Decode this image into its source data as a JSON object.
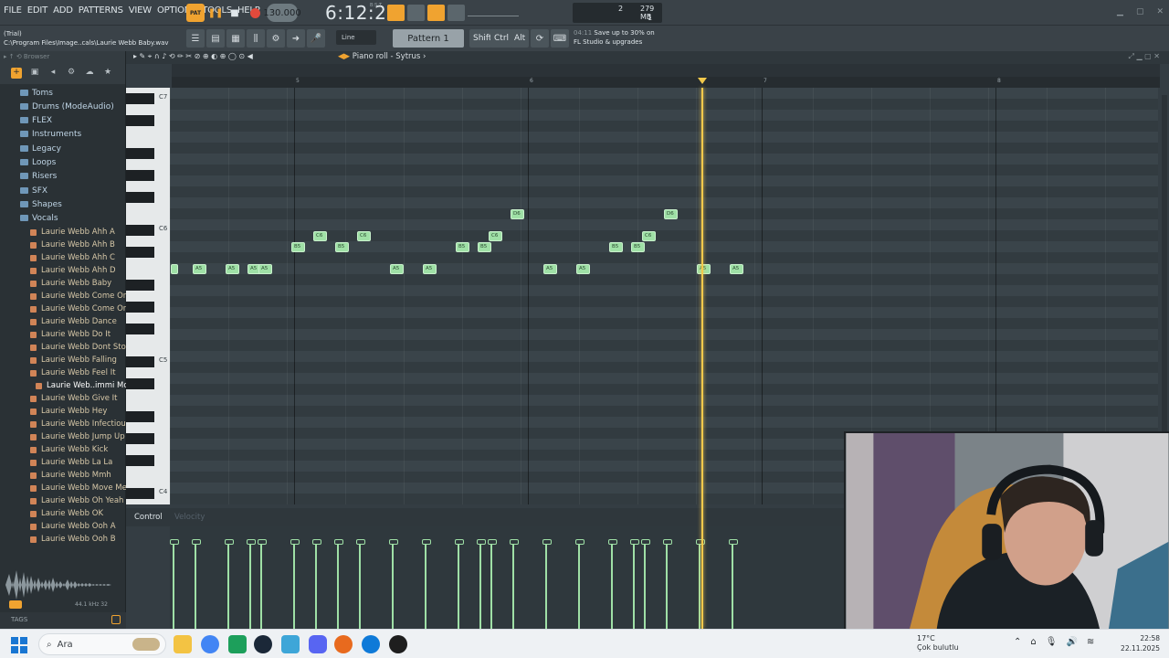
{
  "menu": [
    "FILE",
    "EDIT",
    "ADD",
    "PATTERNS",
    "VIEW",
    "OPTIONS",
    "TOOLS",
    "HELP"
  ],
  "transport": {
    "pat_label": "PAT",
    "song_label": "SONG",
    "tempo": "130.000",
    "time": "6:12:23",
    "time_unit": "B:S:T",
    "cpu": "2",
    "memory": "279 MB",
    "voices": "1"
  },
  "project": {
    "trial": "(Trial)",
    "path": "C:\\Program Files\\Image..cals\\Laurie Webb Baby.wav"
  },
  "toolbar2": {
    "snap": "Line",
    "pattern": "Pattern 1",
    "shift": "Shift",
    "ctrl": "Ctrl",
    "alt": "Alt"
  },
  "promo": {
    "time": "04:11",
    "line1": "Save up to 30% on",
    "line2": "FL Studio & upgrades"
  },
  "browser": {
    "header": "Browser",
    "folders": [
      "Toms",
      "Drums (ModeAudio)",
      "FLEX",
      "Instruments",
      "Legacy",
      "Loops",
      "Risers",
      "SFX",
      "Shapes",
      "Vocals"
    ],
    "files": [
      "Laurie Webb Ahh A",
      "Laurie Webb Ahh B",
      "Laurie Webb Ahh C",
      "Laurie Webb Ahh D",
      "Laurie Webb Baby",
      "Laurie Webb Come On A",
      "Laurie Webb Come On B",
      "Laurie Webb Dance",
      "Laurie Webb Do It",
      "Laurie Webb Dont Stop",
      "Laurie Webb Falling",
      "Laurie Webb Feel It",
      "Laurie Web..immi More",
      "Laurie Webb Give It",
      "Laurie Webb Hey",
      "Laurie Webb Infectious",
      "Laurie Webb Jump Up",
      "Laurie Webb Kick",
      "Laurie Webb La La",
      "Laurie Webb Mmh",
      "Laurie Webb Move Me",
      "Laurie Webb Oh Yeah",
      "Laurie Webb OK",
      "Laurie Webb Ooh A",
      "Laurie Webb Ooh B"
    ],
    "selected_file": "Laurie Web..immi More",
    "sample_info": "44.1 kHz 32",
    "tags": "TAGS"
  },
  "pianoroll": {
    "title": "Piano roll - Sytrus",
    "bars": [
      "5",
      "6",
      "7",
      "8"
    ],
    "octaves": [
      "C7",
      "C6",
      "C5",
      "C4"
    ],
    "control_label": "Control",
    "control_target": "Velocity",
    "notes": [
      {
        "label": "",
        "pitch": "A5",
        "beat": 0
      },
      {
        "label": "A5",
        "pitch": "A5",
        "beat": 1
      },
      {
        "label": "A5",
        "pitch": "A5",
        "beat": 2.5
      },
      {
        "label": "A5",
        "pitch": "A5",
        "beat": 3.5
      },
      {
        "label": "A5",
        "pitch": "A5",
        "beat": 4
      },
      {
        "label": "B5",
        "pitch": "B5",
        "beat": 5.5
      },
      {
        "label": "C6",
        "pitch": "C6",
        "beat": 6.5
      },
      {
        "label": "B5",
        "pitch": "B5",
        "beat": 7.5
      },
      {
        "label": "C6",
        "pitch": "C6",
        "beat": 8.5
      },
      {
        "label": "A5",
        "pitch": "A5",
        "beat": 10
      },
      {
        "label": "A5",
        "pitch": "A5",
        "beat": 11.5
      },
      {
        "label": "B5",
        "pitch": "B5",
        "beat": 13
      },
      {
        "label": "B5",
        "pitch": "B5",
        "beat": 14
      },
      {
        "label": "C6",
        "pitch": "C6",
        "beat": 14.5
      },
      {
        "label": "D6",
        "pitch": "D6",
        "beat": 15.5
      },
      {
        "label": "A5",
        "pitch": "A5",
        "beat": 17
      },
      {
        "label": "A5",
        "pitch": "A5",
        "beat": 18.5
      },
      {
        "label": "B5",
        "pitch": "B5",
        "beat": 20
      },
      {
        "label": "B5",
        "pitch": "B5",
        "beat": 21
      },
      {
        "label": "C6",
        "pitch": "C6",
        "beat": 21.5
      },
      {
        "label": "D6",
        "pitch": "D6",
        "beat": 22.5
      },
      {
        "label": "A5",
        "pitch": "A5",
        "beat": 24
      },
      {
        "label": "A5",
        "pitch": "A5",
        "beat": 25.5
      }
    ]
  },
  "taskbar": {
    "search": "Ara",
    "weather_temp": "17°C",
    "weather_text": "Çok bulutlu",
    "time": "22:58",
    "date": "22.11.2025"
  },
  "colors": {
    "accent": "#f0a330",
    "note": "#9fe0a6",
    "playhead": "#f2c94c"
  }
}
